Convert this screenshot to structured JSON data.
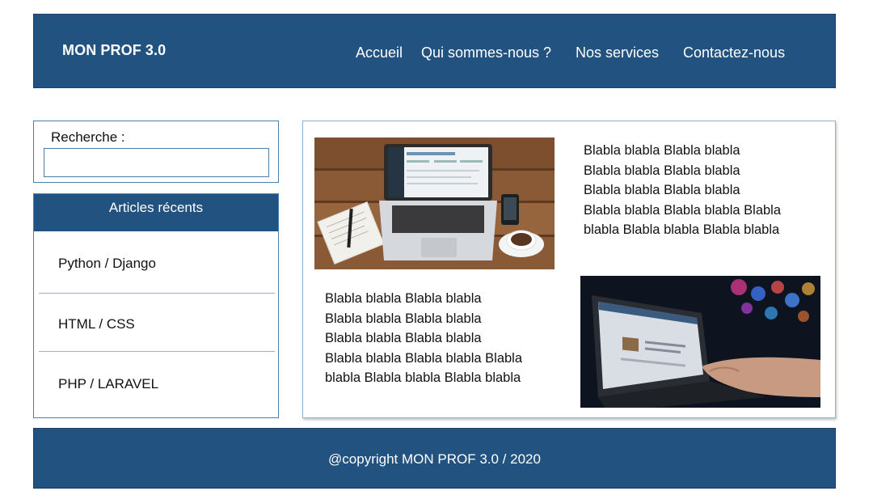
{
  "header": {
    "brand": "MON PROF 3.0",
    "nav": [
      "Accueil",
      "Qui sommes-nous ?",
      "Nos services",
      "Contactez-nous"
    ]
  },
  "search": {
    "label": "Recherche :",
    "value": "",
    "placeholder": ""
  },
  "articles": {
    "title": "Articles récents",
    "items": [
      "Python / Django",
      "HTML / CSS",
      "PHP / LARAVEL"
    ]
  },
  "main": {
    "block1": {
      "lines": [
        "Blabla blabla Blabla blabla",
        "Blabla blabla Blabla blabla",
        "Blabla blabla Blabla blabla",
        "Blabla blabla Blabla blabla Blabla",
        "blabla Blabla blabla Blabla blabla"
      ]
    },
    "block2": {
      "lines": [
        "Blabla blabla Blabla blabla",
        "Blabla blabla Blabla blabla",
        "Blabla blabla Blabla blabla",
        "Blabla blabla Blabla blabla Blabla",
        "blabla Blabla blabla Blabla blabla"
      ]
    }
  },
  "footer": {
    "text": "@copyright MON PROF 3.0 / 2020"
  },
  "colors": {
    "primary": "#22527f",
    "border": "#4d7fad",
    "divider": "#8fb3d1"
  }
}
